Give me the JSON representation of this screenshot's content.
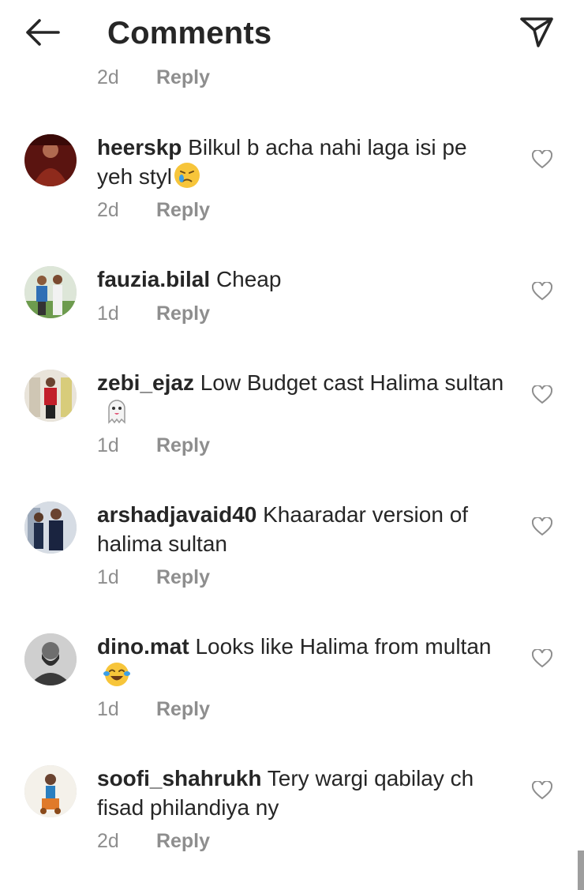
{
  "header": {
    "title": "Comments"
  },
  "partial_meta": {
    "time": "2d",
    "reply": "Reply"
  },
  "comments": [
    {
      "username": "heerskp",
      "text": "Bilkul b acha nahi laga isi pe yeh styl",
      "emoji": "crying-face",
      "time": "2d",
      "reply": "Reply"
    },
    {
      "username": "fauzia.bilal",
      "text": "Cheap",
      "time": "1d",
      "reply": "Reply"
    },
    {
      "username": "zebi_ejaz",
      "text": "Low Budget cast Halima sultan",
      "emoji": "ghost",
      "time": "1d",
      "reply": "Reply"
    },
    {
      "username": "arshadjavaid40",
      "text": "Khaaradar version of halima sultan",
      "time": "1d",
      "reply": "Reply"
    },
    {
      "username": "dino.mat",
      "text": "Looks like Halima from multan",
      "emoji": "tears-of-joy",
      "time": "1d",
      "reply": "Reply"
    },
    {
      "username": "soofi_shahrukh",
      "text": "Tery wargi qabilay ch fisad philandiya ny",
      "time": "2d",
      "reply": "Reply"
    }
  ],
  "colors": {
    "text": "#262626",
    "muted": "#8e8e8e",
    "background": "#ffffff"
  }
}
